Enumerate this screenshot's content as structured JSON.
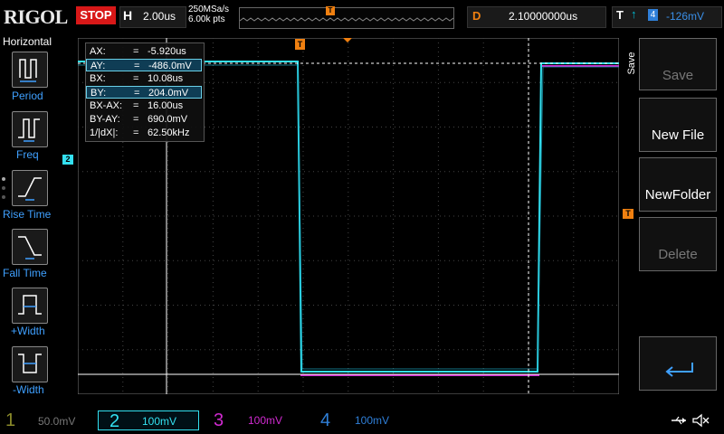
{
  "brand": "RIGOL",
  "run_state": "STOP",
  "horizontal": {
    "label": "H",
    "timebase": "2.00us",
    "sample_rate": "250MSa/s",
    "memory_points": "6.00k pts"
  },
  "delay": {
    "label": "D",
    "value": "2.10000000us"
  },
  "trigger": {
    "label": "T",
    "edge": "↑",
    "source": "4",
    "level": "-126mV"
  },
  "left_menu": {
    "title": "Horizontal",
    "items": [
      {
        "label": "Period",
        "icon": "period-icon"
      },
      {
        "label": "Freq",
        "icon": "freq-icon"
      },
      {
        "label": "Rise Time",
        "icon": "rise-time-icon"
      },
      {
        "label": "Fall Time",
        "icon": "fall-time-icon"
      },
      {
        "label": "+Width",
        "icon": "positive-width-icon"
      },
      {
        "label": "-Width",
        "icon": "negative-width-icon"
      }
    ]
  },
  "cursor": {
    "rows": [
      {
        "name": "AX:",
        "eq": "=",
        "val": "-5.920us",
        "highlight": false
      },
      {
        "name": "AY:",
        "eq": "=",
        "val": "-486.0mV",
        "highlight": true
      },
      {
        "name": "BX:",
        "eq": "=",
        "val": "10.08us",
        "highlight": false
      },
      {
        "name": "BY:",
        "eq": "=",
        "val": "204.0mV",
        "highlight": true
      },
      {
        "name": "BX-AX:",
        "eq": "=",
        "val": "16.00us",
        "highlight": false
      },
      {
        "name": "BY-AY:",
        "eq": "=",
        "val": "690.0mV",
        "highlight": false
      },
      {
        "name": "1/|dX|:",
        "eq": "=",
        "val": "62.50kHz",
        "highlight": false
      }
    ]
  },
  "right_menu": {
    "title": "Save",
    "items": [
      {
        "label": "Save",
        "enabled": false
      },
      {
        "label": "New File",
        "enabled": true
      },
      {
        "label": "NewFolder",
        "enabled": true
      },
      {
        "label": "Delete",
        "enabled": false
      }
    ],
    "back_icon": "return-arrow-icon"
  },
  "channels": [
    {
      "num": "1",
      "scale": "50.0mV",
      "color": "#8a8a2a",
      "active": false
    },
    {
      "num": "2",
      "scale": "100mV",
      "color": "#33e0f0",
      "active": true
    },
    {
      "num": "3",
      "scale": "100mV",
      "color": "#d02ad0",
      "active": false
    },
    {
      "num": "4",
      "scale": "100mV",
      "color": "#2f7fd8",
      "active": false
    }
  ],
  "markers": {
    "ch2": "2",
    "trigger_level": "T",
    "trigger_pos": "T"
  },
  "status_icons": [
    "usb-icon",
    "speaker-muted-icon"
  ],
  "colors": {
    "ch2": "#33e0f0",
    "ch3": "#d02ad0",
    "ch4": "#2f7fd8",
    "trigger": "#f08010",
    "accent": "#3fa0ff"
  }
}
